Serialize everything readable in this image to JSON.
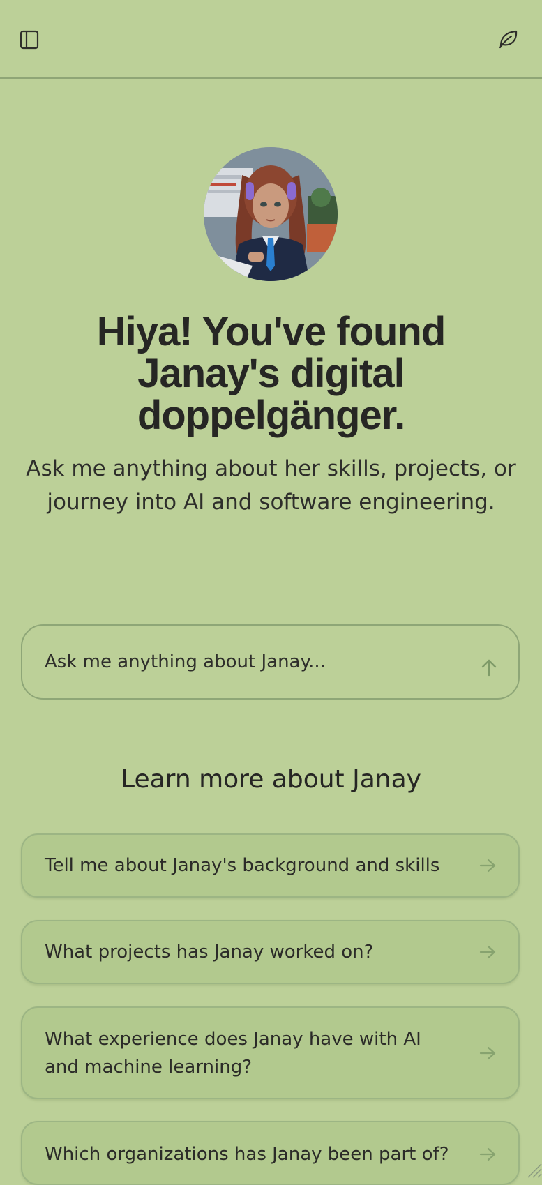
{
  "header": {
    "sidebar_toggle_icon": "sidebar-panel-icon",
    "theme_icon": "leaf-icon"
  },
  "colors": {
    "background": "#bcd098",
    "card": "#b2c98e",
    "border": "#8ea677",
    "text": "#262624",
    "muted_icon": "#7e9a68"
  },
  "hero": {
    "title_line1": "Hiya! You've found",
    "title_line2": "Janay's digital",
    "title_line3": "doppelgänger.",
    "subtitle_line1": "Ask me anything about her skills, projects, or",
    "subtitle_line2": "journey into AI and software engineering."
  },
  "ask": {
    "placeholder": "Ask me anything about Janay...",
    "send_icon": "arrow-up-icon"
  },
  "suggestions": {
    "title": "Learn more about Janay",
    "items": [
      {
        "label": "Tell me about Janay's background and skills"
      },
      {
        "label": "What projects has Janay worked on?"
      },
      {
        "label": "What experience does Janay have with AI and machine learning?"
      },
      {
        "label": "Which organizations has Janay been part of?"
      }
    ],
    "arrow_icon": "arrow-right-icon"
  }
}
